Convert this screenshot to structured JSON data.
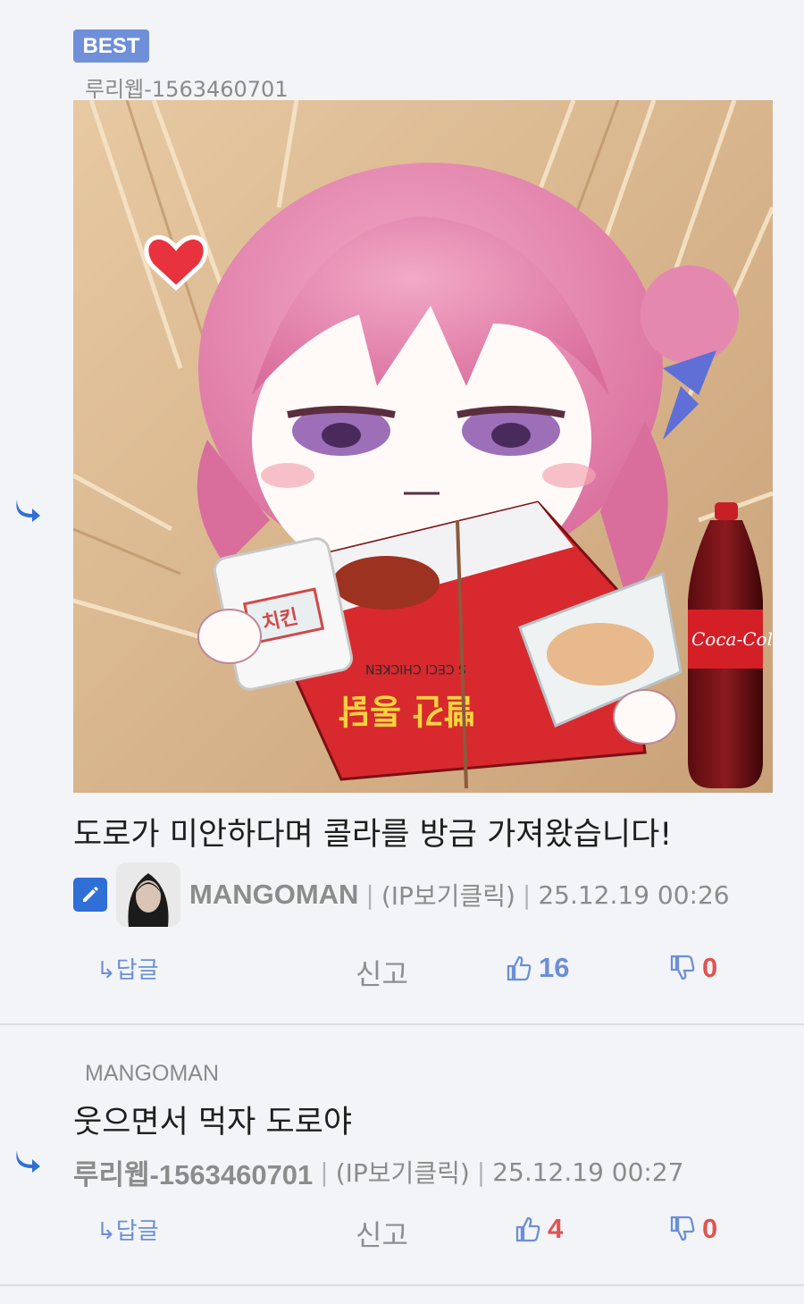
{
  "comments": [
    {
      "badge": "BEST",
      "quote_user": "루리웹-1563460701",
      "text": "도로가 미안하다며 콜라를 방금 가져왔습니다!",
      "author": "MANGOMAN",
      "ip_label": "(IP보기클릭)",
      "datetime": "25.12.19 00:26",
      "reply_label": "답글",
      "report_label": "신고",
      "likes": "16",
      "dislikes": "0",
      "image_labels": {
        "box_label": "치킨",
        "box_brand": "S CECI CHICKEN",
        "drink_brand": "Coca-Cola"
      }
    },
    {
      "quote_user": "MANGOMAN",
      "text": "웃으면서 먹자 도로야",
      "author": "루리웹-1563460701",
      "ip_label": "(IP보기클릭)",
      "datetime": "25.12.19 00:27",
      "reply_label": "답글",
      "report_label": "신고",
      "likes": "4",
      "dislikes": "0"
    }
  ],
  "colors": {
    "accent": "#2f6fd6",
    "badge": "#6f8fd8",
    "like": "#6b8fd6",
    "dislike": "#e05454",
    "background": "#f3f4f8"
  },
  "icons": {
    "reply_arrow": "reply-arrow-icon",
    "edit": "pencil-icon",
    "like": "thumbs-up-icon",
    "dislike": "thumbs-down-icon"
  }
}
